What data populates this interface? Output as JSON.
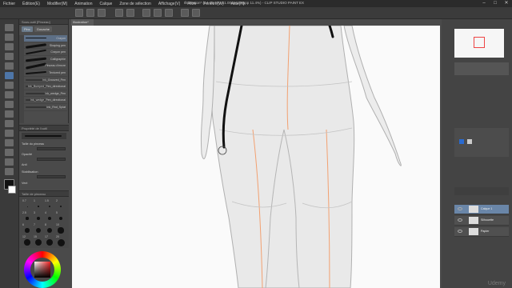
{
  "menu": [
    "Fichier",
    "Édition(E)",
    "Modifier(M)",
    "Animation",
    "Calque",
    "Zone de sélection",
    "Affichage(V)",
    "Filtre",
    "Fenêtre(W)",
    "Aide(H)"
  ],
  "window_title": "Illustration* (A4 29.70 x 21.00cm 300ppp 11.4%) - CLIP STUDIO PAINT EX",
  "canvas_tab": "Illustration*",
  "subtool": {
    "header": "Sous-outil [Pinceau]",
    "tabs": [
      "Pinc",
      "Gouache"
    ],
    "brushes": [
      "Crayon",
      "Shaping pen",
      "Crayon pen",
      "Calligraphie",
      "Pinceau d'encre",
      "Textured pen",
      "Ink_Grooved_Pen",
      "Ink_Bumped_Pen_directional",
      "Ink_wedge_Pen",
      "Ink_wedge_Pen_directional",
      "Ink_Rnd_Splat"
    ]
  },
  "tool_property": {
    "header": "Propriété de l'outil",
    "size_label": "Taille du pinceau",
    "opacity_label": "Opacité",
    "aa_label": "Anti",
    "stab_label": "Stabilisation",
    "vector_label": "Vect"
  },
  "brush_size": {
    "header": "Taille de pinceau",
    "sizes": [
      "0.7",
      "1",
      "1.5",
      "2",
      "2.5",
      "3",
      "4",
      "5",
      "6",
      "7",
      "8",
      "10",
      "12",
      "15",
      "17",
      "20"
    ]
  },
  "layer_panel": {
    "layers": [
      "Calque 1",
      "Silhouette",
      "Papier"
    ]
  },
  "watermark": "Udemy"
}
